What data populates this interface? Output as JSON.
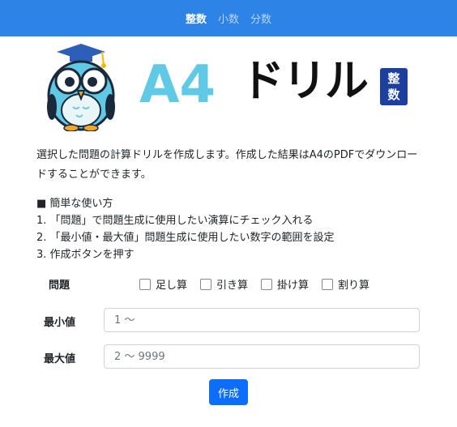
{
  "nav": {
    "items": [
      {
        "label": "整数",
        "active": true
      },
      {
        "label": "小数",
        "active": false
      },
      {
        "label": "分数",
        "active": false
      }
    ],
    "accent": "#2d83e6"
  },
  "logo": {
    "a4": "A4",
    "drill": "ドリル",
    "badge_top": "整",
    "badge_bottom": "数"
  },
  "description": "選択した問題の計算ドリルを作成します。作成した結果はA4のPDFでダウンロードすることができます。",
  "howto": {
    "title": "■ 簡単な使い方",
    "steps": [
      "1. 「問題」で問題生成に使用したい演算にチェック入れる",
      "2. 「最小値・最大値」問題生成に使用したい数字の範囲を設定",
      "3. 作成ボタンを押す"
    ]
  },
  "form": {
    "problems_label": "問題",
    "options": [
      {
        "label": "足し算",
        "checked": false
      },
      {
        "label": "引き算",
        "checked": false
      },
      {
        "label": "掛け算",
        "checked": false
      },
      {
        "label": "割り算",
        "checked": false
      }
    ],
    "min_label": "最小値",
    "min_placeholder": "1 ～",
    "max_label": "最大値",
    "max_placeholder": "2 ～ 9999",
    "submit_label": "作成"
  }
}
